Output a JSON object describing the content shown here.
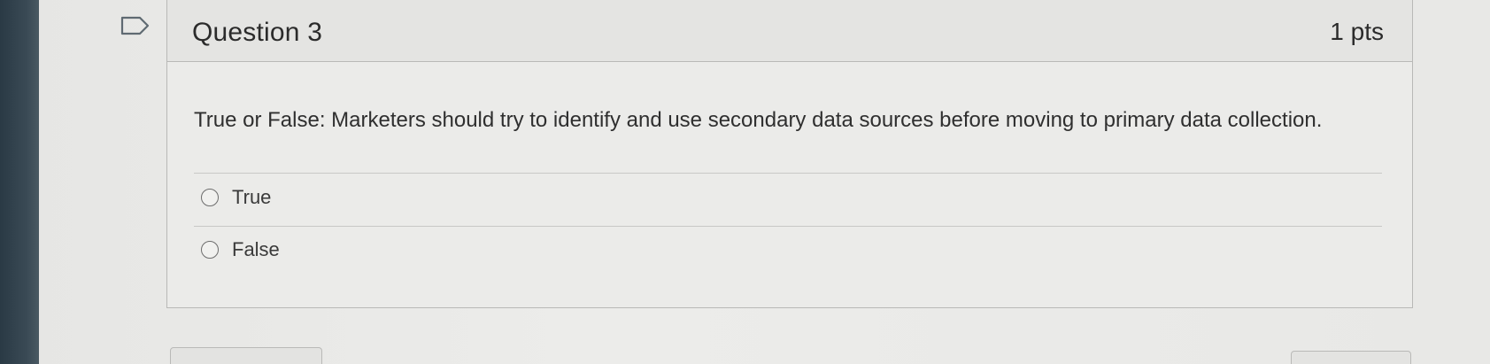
{
  "question": {
    "title": "Question 3",
    "points": "1 pts",
    "text": "True or False: Marketers should try to identify and use secondary data sources before moving to primary data collection.",
    "answers": [
      {
        "label": "True",
        "selected": false
      },
      {
        "label": "False",
        "selected": false
      }
    ]
  },
  "icons": {
    "flag": "bookmark-flag-icon"
  }
}
